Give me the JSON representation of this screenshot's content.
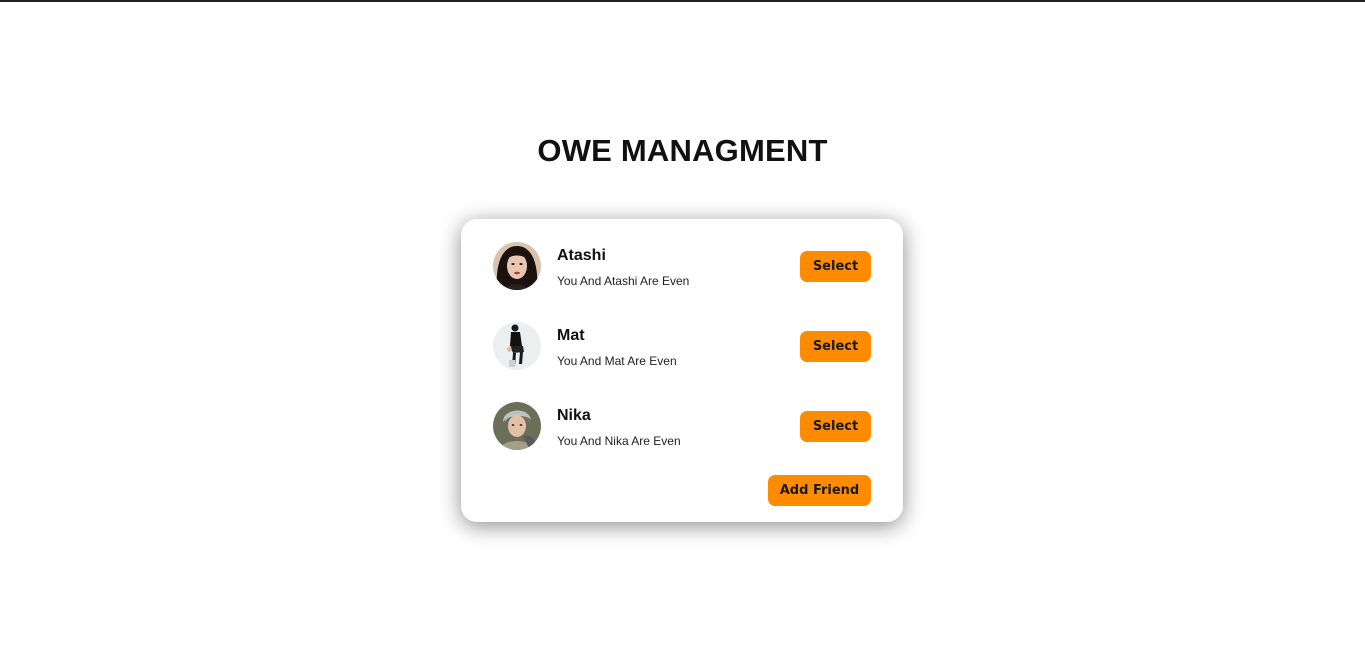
{
  "page": {
    "title": "OWE MANAGMENT"
  },
  "friends": [
    {
      "name": "Atashi",
      "status": "You And Atashi Are Even",
      "select_label": "Select",
      "avatar_icon": "avatar-photo-atashi"
    },
    {
      "name": "Mat",
      "status": "You And Mat Are Even",
      "select_label": "Select",
      "avatar_icon": "avatar-photo-mat"
    },
    {
      "name": "Nika",
      "status": "You And Nika Are Even",
      "select_label": "Select",
      "avatar_icon": "avatar-photo-nika"
    }
  ],
  "actions": {
    "add_friend_label": "Add Friend"
  },
  "colors": {
    "accent": "#ff8c00",
    "text": "#111111",
    "background": "#ffffff"
  }
}
